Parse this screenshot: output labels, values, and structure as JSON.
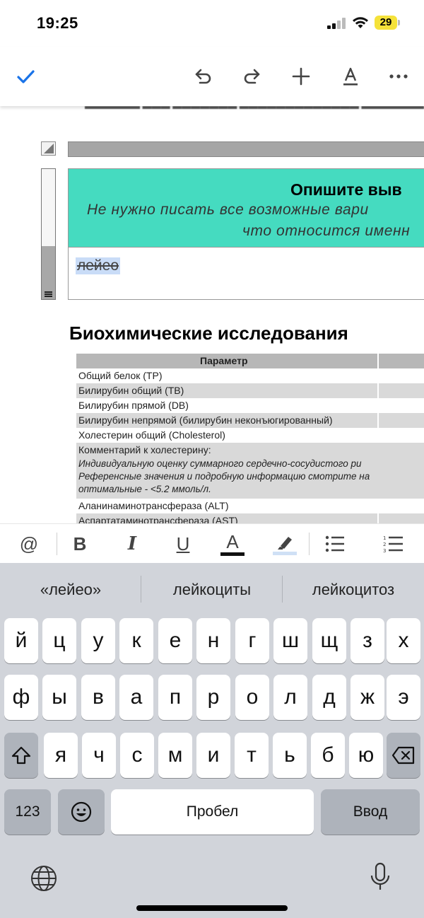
{
  "status_bar": {
    "time": "19:25",
    "battery": "29"
  },
  "toolbar": {
    "done_icon": "check-icon",
    "undo_icon": "undo-icon",
    "redo_icon": "redo-icon",
    "add_icon": "plus-icon",
    "text_format_icon": "text-format-icon",
    "more_icon": "more-icon"
  },
  "document": {
    "card_heading": "Опишите выв",
    "card_sub_line1": "Не нужно писать все возможные вари",
    "card_sub_line2": "что относится именн",
    "answer_text": "лейео",
    "section_title": "Биохимические исследования",
    "table": {
      "header": "Параметр",
      "rows": [
        "Общий белок (TP)",
        "Билирубин общий (TB)",
        "Билирубин прямой (DB)",
        "Билирубин непрямой (билирубин неконъюгированный)",
        "Холестерин общий (Cholesterol)"
      ],
      "comment_label": "Комментарий к холестерину:",
      "comment_lines": [
        "Индивидуальную оценку суммарного сердечно-сосудистого ри",
        "Референсные значения и подробную информацию смотрите на",
        "оптимальные - <5.2 ммоль/л."
      ],
      "rows_after": [
        "Аланинаминотрансфераза (ALT)",
        "Аспартатаминотрансфераза (AST)"
      ]
    }
  },
  "format_bar": {
    "mention": "@",
    "bold": "B",
    "italic": "I",
    "underline": "U",
    "text_color": "A",
    "text_color_hex": "#111111",
    "highlight_hex": "#cfe0f5"
  },
  "keyboard": {
    "suggestions": [
      "«лейео»",
      "лейкоциты",
      "лейкоцитоз"
    ],
    "row1": [
      "й",
      "ц",
      "у",
      "к",
      "е",
      "н",
      "г",
      "ш",
      "щ",
      "з",
      "х"
    ],
    "row2": [
      "ф",
      "ы",
      "в",
      "а",
      "п",
      "р",
      "о",
      "л",
      "д",
      "ж",
      "э"
    ],
    "row3": [
      "я",
      "ч",
      "с",
      "м",
      "и",
      "т",
      "ь",
      "б",
      "ю"
    ],
    "numbers_key": "123",
    "space_key": "Пробел",
    "return_key": "Ввод"
  }
}
